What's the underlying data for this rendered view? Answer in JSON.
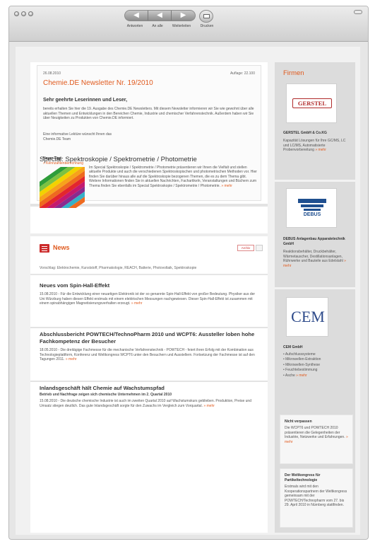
{
  "toolbar": {
    "buttons": [
      "◀",
      "◀",
      "▶",
      "▶"
    ],
    "labels": [
      "Antworten",
      "An alle",
      "Weiterleiten",
      "Drucken"
    ]
  },
  "newsletter": {
    "date": "26.08.2010",
    "edition": "Auflage: 22.100",
    "title": "Chemie.DE Newsletter Nr. 19/2010",
    "greeting": "Sehr geehrte Leserinnen und Leser,",
    "intro": "bereits erhalten Sie hier die 19. Ausgabe des Chemie.DE Newsletters. Mit diesem Newsletter informieren wir Sie wie gewohnt über alle aktuellen Themen und Entwicklungen in den Bereichen Chemie, Industrie und chemischer Verfahrenstechnik. Außerdem haben wir Sie über Neuigkeiten zu Produkten von Chemie.DE informiert.",
    "signature": [
      "Eine informative Lektüre wünscht Ihnen das",
      "Chemie.DE Team"
    ],
    "tipp_heading": "Neuer Tipp",
    "tipp_link": "» Kennzahlenberechnung"
  },
  "special": {
    "title": "Special: Spektroskopie / Spektrometrie / Photometrie",
    "text": "Im Special Spektroskopie / Spektrometrie / Photometrie präsentieren wir Ihnen die Vielfalt und stellen aktuelle Produkte und auch die verschiedenen Spektroskopischen und photometrischen Methoden vor. Hier finden Sie darüber hinaus alle auf die Spektroskopie bezogenen Themen, die es zu dem Thema gibt. Weitere Informationen finden Sie in aktuellen Nachrichten, Fachartikeln, Veranstaltungen und Büchern zum Thema finden Sie ebenfalls im Special Spektroskopie / Spektrometrie / Photometrie.",
    "more": "» mehr"
  },
  "news": {
    "label": "News",
    "button": "Archiv",
    "tags": "Vorschlag: Elektrochemie, Kunststoff, Pharmakologie, REACH, Batterie, Photovoltaik, Spektroskopie",
    "articles": [
      {
        "title": "Neues vom Spin-Hall-Effekt",
        "subtitle": "",
        "text": "15.08.2010 - Für die Entwicklung einer neuartigen Elektronik ist der so genannte Spin-Hall-Effekt von großer Bedeutung. Physiker aus der Uni Würzburg haben diesen Effekt erstmals mit einem elektrischen Messungen nachgewiesen. Dieser Spin-Hall-Effekt ist zusammen mit einem spinabhängigen Magnetisierungsverhalten erzeugt.",
        "more": "» mehr"
      },
      {
        "title": "Abschlussbericht POWTECH/TechnoPharm 2010 und WCPT6: Aussteller loben hohe Fachkompetenz der Besucher",
        "subtitle": "",
        "text": "18.05.2010 - Die dreitägige Fachmesse für die mechanische Verfahrenstechnik - POWTECH - feiert ihren Erfolg mit der Kombination aus Technologieplattform, Konferenz und Weltkongress WCPT6 unter den Besuchern und Ausstellern. Fortsetzung der Fachmesse ist auf den Tagungen 2011.",
        "more": "» mehr"
      },
      {
        "title": "Inlandsgeschäft hält Chemie auf Wachstumspfad",
        "subtitle": "Betrieb und Nachfrage zeigen sich chemische Unternehmen im 2. Quartal 2010",
        "text": "15.08.2010 - Die deutsche chemische Industrie ist auch im zweiten Quartal 2010 auf Wachstumskurs geblieben. Produktion, Preise und Umsatz stiegen deutlich. Das gute Inlandsgeschäft sorgte für den Zuwachs im Vergleich zum Vorquartal.",
        "more": "» mehr"
      }
    ]
  },
  "sidebar": {
    "heading": "Firmen",
    "companies": [
      {
        "logo_text": "GERSTEL",
        "name": "GERSTEL GmbH & Co.KG",
        "desc": "Kapazität Lösungen für Ihre GC/MS, LC und LC/MS, Automatisierte Probenvorbereitung",
        "more": "» mehr"
      },
      {
        "logo_text": "DEBUS",
        "name": "DEBUS Anlagenbau Apparatetechnik GmbH",
        "desc": "Reaktionsbehälter, Druckbehälter, Wärmetauscher, Destillationsanlagen, Rührwerke und Bauteile aus Edelstahl",
        "more": "» mehr"
      },
      {
        "logo_text": "CEM",
        "name": "CEM GmbH",
        "items": [
          "• Aufschlusssysteme",
          "• Mikrowellen-Extraktion",
          "• Mikrowellen-Synthese",
          "• Feuchtebestimmung",
          "• Asche"
        ],
        "more": "» mehr"
      }
    ],
    "box1": {
      "title": "Nicht verpassen",
      "text": "Die WCPT6 und POWTECH 2010 präsentieren die Gelegenheiten der Industrie, Netzwerke und Erfahrungen.",
      "more": "» mehr"
    },
    "box2": {
      "title": "Der Weltkongress für Partikeltechnologie",
      "text": "Erstmals wird mit den Kooperationspartnern der Weltkongress gemeinsam mit der POWTECH/Technopharm vom 27. bis 29. April 2010 in Nürnberg stattfinden."
    }
  },
  "colors": {
    "accent": "#e05a1e",
    "news_icon": "#cc2b2b"
  }
}
